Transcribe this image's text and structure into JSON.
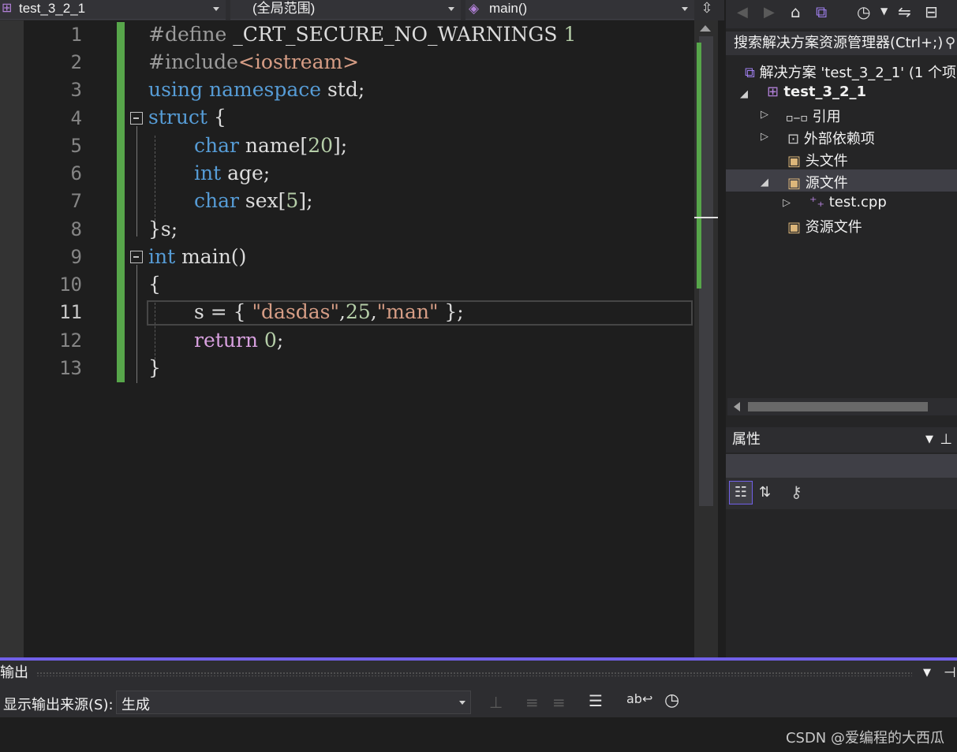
{
  "navbar": {
    "project": "test_3_2_1",
    "scope": "(全局范围)",
    "member": "main()"
  },
  "editor": {
    "lines": [
      {
        "n": "1"
      },
      {
        "n": "2"
      },
      {
        "n": "3"
      },
      {
        "n": "4"
      },
      {
        "n": "5"
      },
      {
        "n": "6"
      },
      {
        "n": "7"
      },
      {
        "n": "8"
      },
      {
        "n": "9"
      },
      {
        "n": "10"
      },
      {
        "n": "11"
      },
      {
        "n": "12"
      },
      {
        "n": "13"
      }
    ],
    "code": {
      "l1_a": "#define",
      "l1_b": " _CRT_SECURE_NO_WARNINGS ",
      "l1_c": "1",
      "l2_a": "#include",
      "l2_b": "<iostream>",
      "l3_a": "using",
      "l3_b": " ",
      "l3_c": "namespace",
      "l3_d": " std;",
      "l4_a": "struct",
      "l4_b": " {",
      "l5_a": "char",
      "l5_b": " name[",
      "l5_c": "20",
      "l5_d": "];",
      "l6_a": "int",
      "l6_b": " age;",
      "l7_a": "char",
      "l7_b": " sex[",
      "l7_c": "5",
      "l7_d": "];",
      "l8": "}s;",
      "l9_a": "int",
      "l9_b": " main()",
      "l10": "{",
      "l11_a": "s = { ",
      "l11_b": "\"dasdas\"",
      "l11_c": ",",
      "l11_d": "25",
      "l11_e": ",",
      "l11_f": "\"man\"",
      "l11_g": " };",
      "l12_a": "return",
      "l12_b": " ",
      "l12_c": "0",
      "l12_d": ";",
      "l13": "}"
    }
  },
  "solution_explorer": {
    "search_label": "搜索解决方案资源管理器(Ctrl+;)",
    "solution": "解决方案 'test_3_2_1' (1 个项",
    "project": "test_3_2_1",
    "items": [
      {
        "label": "引用"
      },
      {
        "label": "外部依赖项"
      },
      {
        "label": "头文件"
      },
      {
        "label": "源文件"
      },
      {
        "label": "test.cpp"
      },
      {
        "label": "资源文件"
      }
    ]
  },
  "properties": {
    "title": "属性"
  },
  "output": {
    "title": "输出",
    "source_label": "显示输出来源(S):",
    "source_value": "生成"
  },
  "watermark": "CSDN @爱编程的大西瓜",
  "colors": {
    "accent": "#7160e8",
    "change_bar": "#57a64a",
    "keyword": "#569cd6",
    "string": "#d69d85",
    "number": "#b5cea8"
  }
}
